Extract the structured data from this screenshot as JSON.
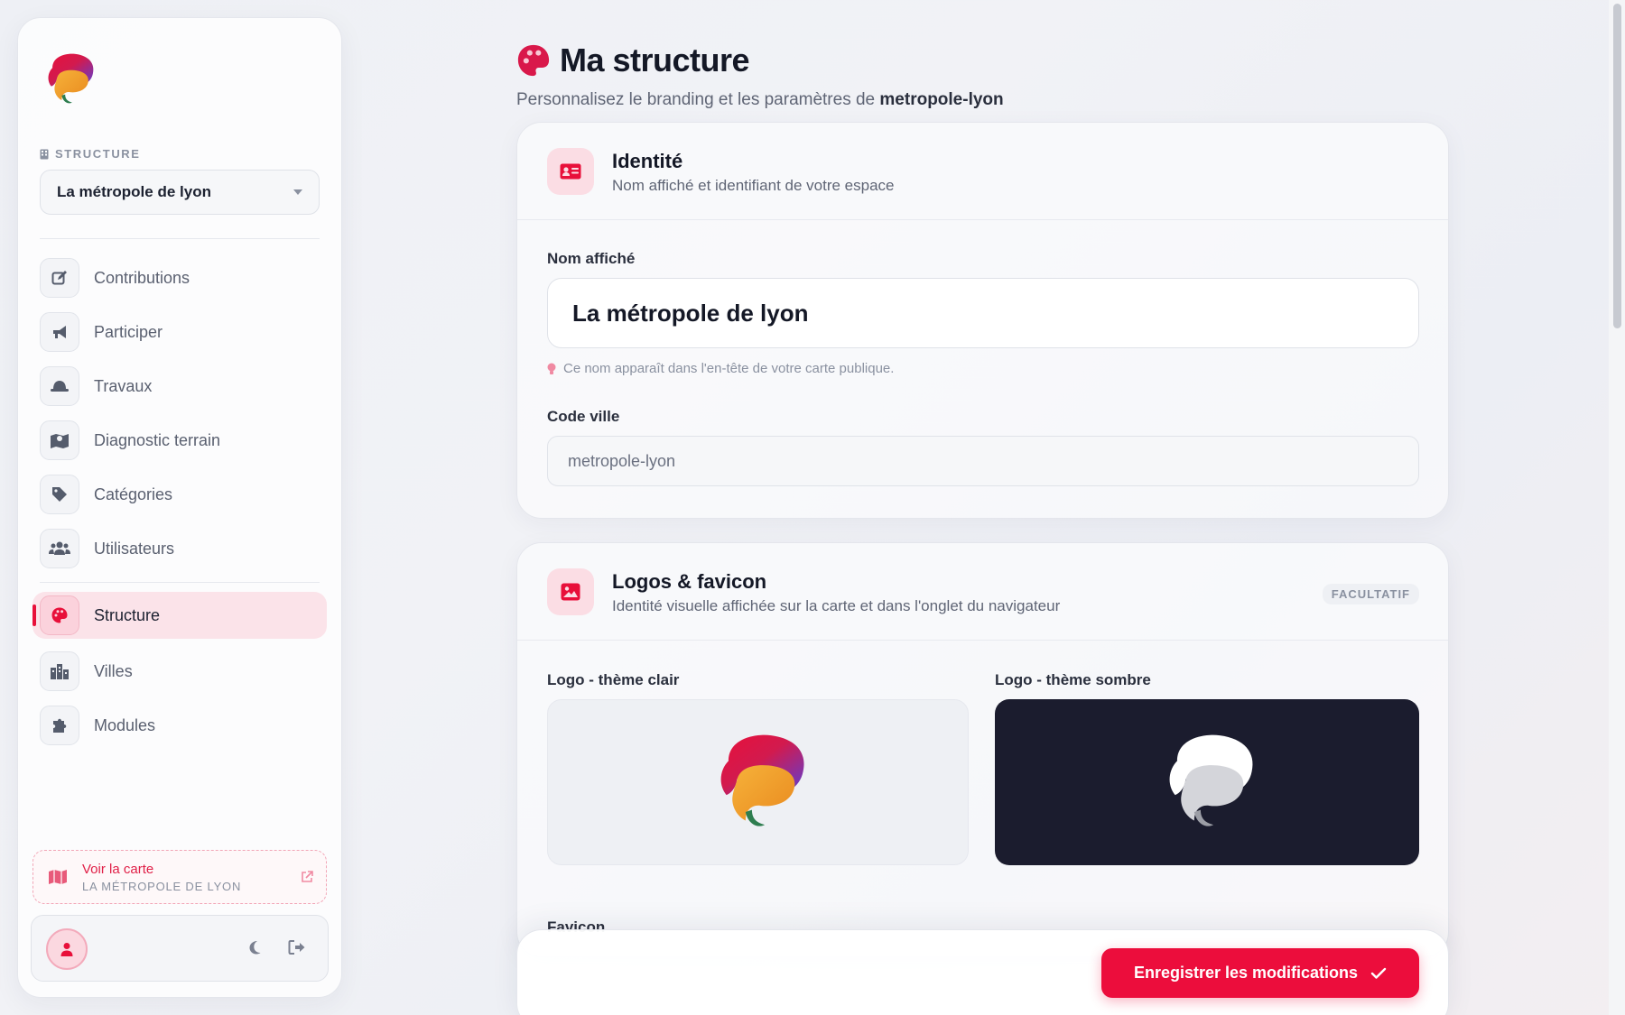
{
  "sidebar": {
    "structure_label": "STRUCTURE",
    "structure_select": "La métropole de lyon",
    "items": [
      {
        "label": "Contributions",
        "icon": "edit-icon"
      },
      {
        "label": "Participer",
        "icon": "megaphone-icon"
      },
      {
        "label": "Travaux",
        "icon": "hard-hat-icon"
      },
      {
        "label": "Diagnostic terrain",
        "icon": "map-marker-icon"
      },
      {
        "label": "Catégories",
        "icon": "tags-icon"
      },
      {
        "label": "Utilisateurs",
        "icon": "users-icon"
      },
      {
        "label": "Structure",
        "icon": "palette-icon",
        "active": true
      },
      {
        "label": "Villes",
        "icon": "city-icon"
      },
      {
        "label": "Modules",
        "icon": "puzzle-icon"
      }
    ],
    "map_link": {
      "title": "Voir la carte",
      "subtitle": "LA MÉTROPOLE DE LYON"
    }
  },
  "header": {
    "title": "Ma structure",
    "subtitle_prefix": "Personnalisez le branding et les paramètres de",
    "subtitle_code": "metropole-lyon"
  },
  "identity": {
    "title": "Identité",
    "desc": "Nom affiché et identifiant de votre espace",
    "name_label": "Nom affiché",
    "name_value": "La métropole de lyon",
    "name_hint": "Ce nom apparaît dans l'en-tête de votre carte publique.",
    "code_label": "Code ville",
    "code_value": "metropole-lyon"
  },
  "logos": {
    "title": "Logos & favicon",
    "desc": "Identité visuelle affichée sur la carte et dans l'onglet du navigateur",
    "badge": "FACULTATIF",
    "light_label": "Logo - thème clair",
    "dark_label": "Logo - thème sombre",
    "favicon_label": "Favicon"
  },
  "actions": {
    "save": "Enregistrer les modifications"
  },
  "colors": {
    "accent": "#ec0d3c",
    "dark_bg": "#1b1c2e"
  }
}
